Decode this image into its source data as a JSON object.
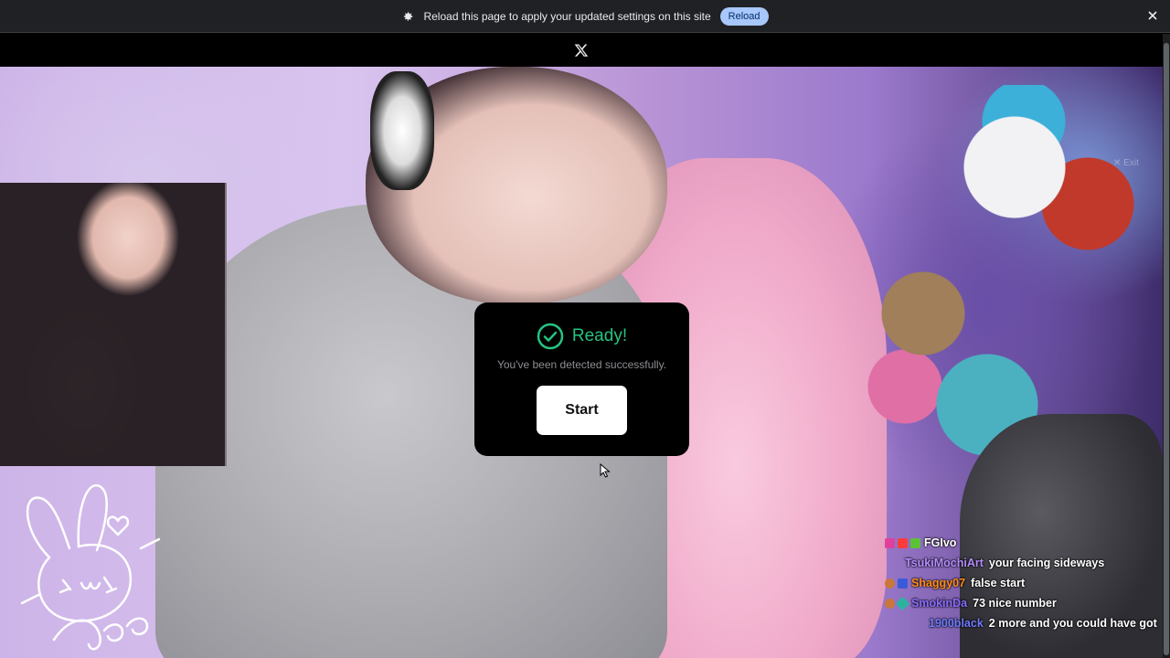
{
  "infobar": {
    "message": "Reload this page to apply your updated settings on this site",
    "reload_label": "Reload",
    "icons": [
      "gear-icon",
      "close-icon"
    ]
  },
  "header": {
    "logo_icon": "x-logo-icon"
  },
  "modal": {
    "title": "Ready!",
    "subtitle": "You've been detected successfully.",
    "start_label": "Start",
    "accent_color": "#26c281"
  },
  "overlay": {
    "exit_label": "Exit"
  },
  "chat": {
    "messages": [
      {
        "user": "FGIvo",
        "message": "",
        "color": "#ffffff"
      },
      {
        "user": "TsukiMochiArt",
        "message": "your facing sideways",
        "color": "#b48cff"
      },
      {
        "user": "Shaggy07",
        "message": "false start",
        "color": "#ff8c1a"
      },
      {
        "user": "SmokinDa",
        "message": "73 nice number",
        "color": "#8a6cff"
      },
      {
        "user": "1900black",
        "message": "2 more and you could have got",
        "color": "#6f7cff"
      }
    ]
  }
}
